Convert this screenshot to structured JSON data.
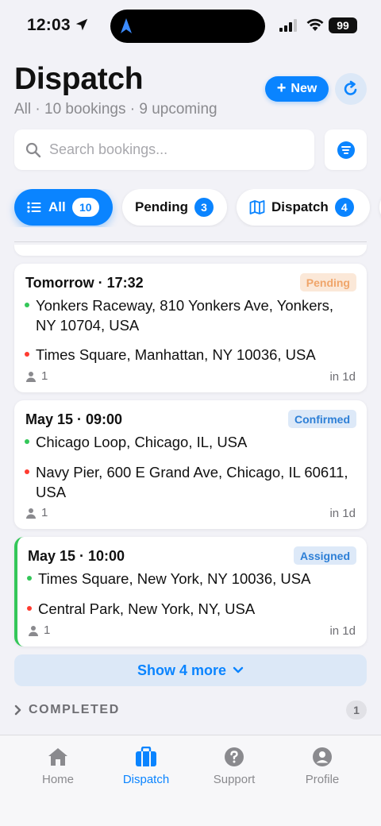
{
  "status_bar": {
    "time": "12:03",
    "battery": "99"
  },
  "header": {
    "title": "Dispatch",
    "subtitle": "All · 10 bookings · 9 upcoming",
    "new_label": "New"
  },
  "search": {
    "placeholder": "Search bookings..."
  },
  "filters": [
    {
      "label": "All",
      "count": "10",
      "active": true
    },
    {
      "label": "Pending",
      "count": "3",
      "active": false
    },
    {
      "label": "Dispatch",
      "count": "4",
      "active": false
    }
  ],
  "bookings": [
    {
      "when": "Tomorrow · 17:32",
      "status": "Pending",
      "pickup": "Yonkers Raceway, 810 Yonkers Ave, Yonkers, NY 10704, USA",
      "dropoff": "Times Square, Manhattan, NY 10036, USA",
      "passengers": "1",
      "eta": "in 1d"
    },
    {
      "when": "May 15 · 09:00",
      "status": "Confirmed",
      "pickup": "Chicago Loop, Chicago, IL, USA",
      "dropoff": "Navy Pier, 600 E Grand Ave, Chicago, IL 60611, USA",
      "passengers": "1",
      "eta": "in 1d"
    },
    {
      "when": "May 15 · 10:00",
      "status": "Assigned",
      "pickup": "Times Square, New York, NY 10036, USA",
      "dropoff": "Central Park, New York, NY, USA",
      "passengers": "1",
      "eta": "in 1d"
    }
  ],
  "show_more_label": "Show 4 more",
  "completed": {
    "label": "COMPLETED",
    "count": "1"
  },
  "tabs": [
    {
      "label": "Home",
      "icon": "home-icon",
      "active": false
    },
    {
      "label": "Dispatch",
      "icon": "briefcase-icon",
      "active": true
    },
    {
      "label": "Support",
      "icon": "help-icon",
      "active": false
    },
    {
      "label": "Profile",
      "icon": "person-icon",
      "active": false
    }
  ],
  "colors": {
    "accent": "#0a84ff",
    "pending": "#f0a56a",
    "confirmed": "#2d7fd6",
    "assigned_bar": "#34c759",
    "pickup_dot": "#34c759",
    "dropoff_dot": "#ff3b30"
  }
}
